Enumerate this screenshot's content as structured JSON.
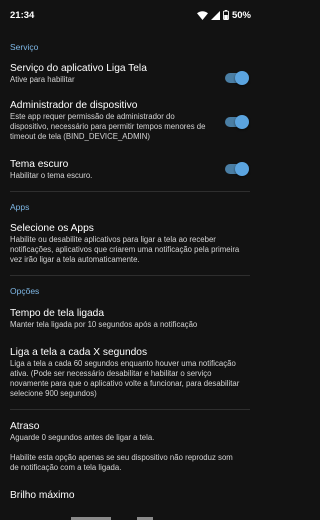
{
  "status_bar": {
    "time": "21:34",
    "battery": "50%"
  },
  "sections": {
    "servico": "Serviço",
    "apps": "Apps",
    "opcoes": "Opções"
  },
  "prefs": {
    "service": {
      "title": "Serviço do aplicativo Liga Tela",
      "summary": "Ative para habilitar",
      "enabled": true
    },
    "admin": {
      "title": "Administrador de dispositivo",
      "summary_lines": [
        "Este app requer permissão de administrador do",
        "dispositivo, necessário para permitir tempos menores de",
        "timeout de tela (BIND_DEVICE_ADMIN)"
      ],
      "enabled": true
    },
    "dark": {
      "title": "Tema escuro",
      "summary": "Habilitar o tema escuro.",
      "enabled": true
    },
    "select_apps": {
      "title": "Selecione os Apps",
      "summary_lines": [
        "Habilite ou desabilite aplicativos para ligar a tela ao receber",
        "notificações, aplicativos que criarem uma notificação pela primeira",
        "vez irão ligar a tela automaticamente."
      ]
    },
    "on_time": {
      "title": "Tempo de tela ligada",
      "summary": "Manter tela ligada por 10 segundos após a notificação"
    },
    "every_x": {
      "title": "Liga a tela a cada X segundos",
      "summary_lines": [
        "Liga a tela a cada 60 segundos enquanto houver uma notificação",
        "ativa. (Pode ser necessário desabilitar e habilitar o serviço",
        "novamente para que o aplicativo volte a funcionar, para desabilitar",
        "selecione 900 segundos)"
      ]
    },
    "delay": {
      "title": "Atraso",
      "summary_lines": [
        "Aguarde 0 segundos antes de ligar a tela.",
        "",
        "Habilite esta opção apenas se seu dispositivo não reproduz som",
        "de notificação com a tela ligada."
      ]
    },
    "brightness": {
      "title": "Brilho máximo"
    }
  }
}
